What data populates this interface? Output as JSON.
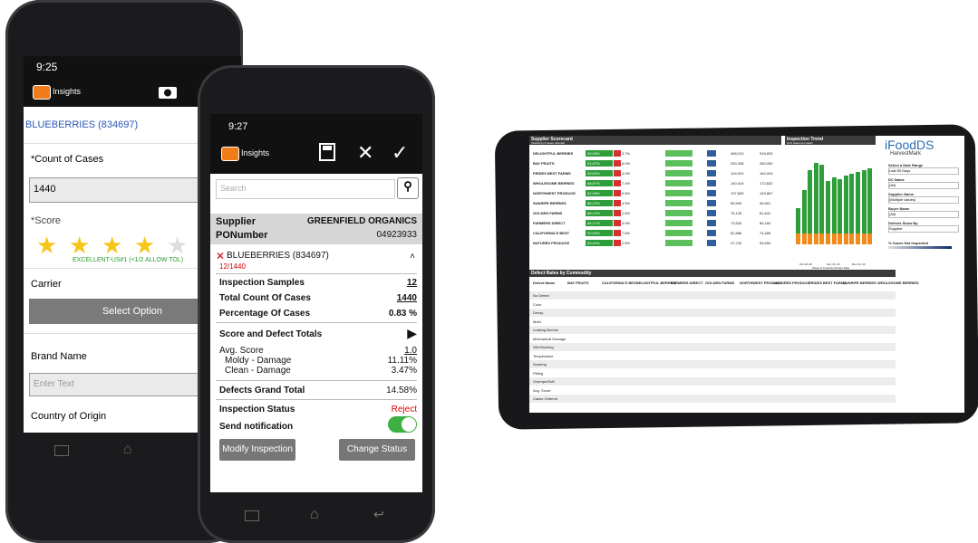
{
  "phone1": {
    "time": "9:25",
    "app_title": "Insights",
    "product": "BLUEBERRIES (834697)",
    "count_label": "*Count of Cases",
    "count_value": "1440",
    "score_label": "*Score",
    "score_rating": 4,
    "score_note": "EXCELLENT-US#1 (<1/2 ALLOW TOL)",
    "carrier_label": "Carrier",
    "select_option": "Select Option",
    "brand_label": "Brand Name",
    "brand_placeholder": "Enter Text",
    "country_label": "Country of Origin"
  },
  "phone2": {
    "time": "9:27",
    "app_title": "Insights",
    "search_placeholder": "Search",
    "supplier_label": "Supplier",
    "supplier_value": "GREENFIELD ORGANICS",
    "po_label": "PONumber",
    "po_value": "04923933",
    "product": "BLUEBERRIES (834697)",
    "product_count": "12/1440",
    "rows": [
      {
        "label": "Inspection Samples",
        "value": "12"
      },
      {
        "label": "Total Count Of Cases",
        "value": "1440"
      },
      {
        "label": "Percentage Of Cases",
        "value": "0.83 %"
      }
    ],
    "score_defect_label": "Score and Defect Totals",
    "avg_score_label": "Avg. Score",
    "avg_score_value": "1.0",
    "moldy_label": "Moldy - Damage",
    "moldy_value": "11.11%",
    "clean_label": "Clean - Damage",
    "clean_value": "3.47%",
    "defects_total_label": "Defects Grand Total",
    "defects_total_value": "14.58%",
    "status_label": "Inspection Status",
    "status_value": "Reject",
    "notify_label": "Send notification",
    "modify_btn": "Modify Inspection",
    "change_btn": "Change Status"
  },
  "tablet": {
    "scorecard_title": "Supplier Scorecard",
    "scorecard_subtitle": "(Sorted by # cases ordered)",
    "trend_title": "Inspection Trend",
    "trend_subtitle": "(# of cases per week)",
    "brand": "iFoodDS",
    "brand_sub": "HarvestMark",
    "filters": [
      {
        "label": "Select a Date Range",
        "value": "Last 90 Days"
      },
      {
        "label": "DC Name",
        "value": "(All)"
      },
      {
        "label": "Supplier Name",
        "value": "(Multiple values)"
      },
      {
        "label": "Buyer Name",
        "value": "(All)"
      },
      {
        "label": "Defects Show By",
        "value": "Supplier"
      }
    ],
    "not_inspected_label": "% Cases Not Inspected",
    "suppliers": [
      "DELIGHTFUL BERRIES",
      "BAY FRUITS",
      "PRIDES BEST FARMS",
      "WHOLESOME BERRIES",
      "NORTHWEST PRODUCE",
      "SUNRIPE BERRIES",
      "GOLDEN FARMS",
      "FARMERS DIRECT",
      "CALIFORNIA'S BEST",
      "NATURES PRODUCE"
    ],
    "green_pct": [
      "90.05%",
      "91.07%",
      "90.83%",
      "88.87%",
      "82.08%",
      "86.12%",
      "88.13%",
      "85.17%",
      "90.00%",
      "83.44%"
    ],
    "red_pct": [
      "3.7%",
      "6.0%",
      "4.0%",
      "7.4%",
      "9.6%",
      "4.5%",
      "2.6%",
      "3.9%",
      "7.6%",
      "2.6%"
    ],
    "cases_inspected": [
      "458,010",
      "250,338",
      "144,024",
      "140,443",
      "137,805",
      "85,599",
      "76,126",
      "73,605",
      "62,886",
      "47,740"
    ],
    "cases_ordered": [
      "515,833",
      "280,050",
      "164,003",
      "172,832",
      "149,867",
      "96,591",
      "81,642",
      "86,180",
      "74,486",
      "55,650"
    ],
    "trend_weeks": [
      "Oct 18, 20",
      "Nov 15, 20",
      "Dec 13, 20"
    ],
    "trend_xlabel": "Week of Inspection/Order Date",
    "defect_title": "Defect Rates by Commodity",
    "defect_columns": [
      "Defect Name",
      "BAY FRUITS",
      "CALIFORNIA'S BEST",
      "DELIGHTFUL BERRIES",
      "FARMERS DIRECT",
      "GOLDEN FARMS",
      "NORTHWEST PRODUCE",
      "NATURES PRODUCE",
      "PRIDES BEST FARMS",
      "SUNRIPE BERRIES",
      "WHOLESOME BERRIES"
    ],
    "defect_rows": [
      "No Defect",
      "Color",
      "Decay",
      "Mold",
      "Leaking Berries",
      "Mechanical Damage",
      "Wet Bruising",
      "Temperature",
      "Scarring",
      "Pitting",
      "Overripe/Soft",
      "Avg. Score",
      "Cases Ordered"
    ]
  }
}
